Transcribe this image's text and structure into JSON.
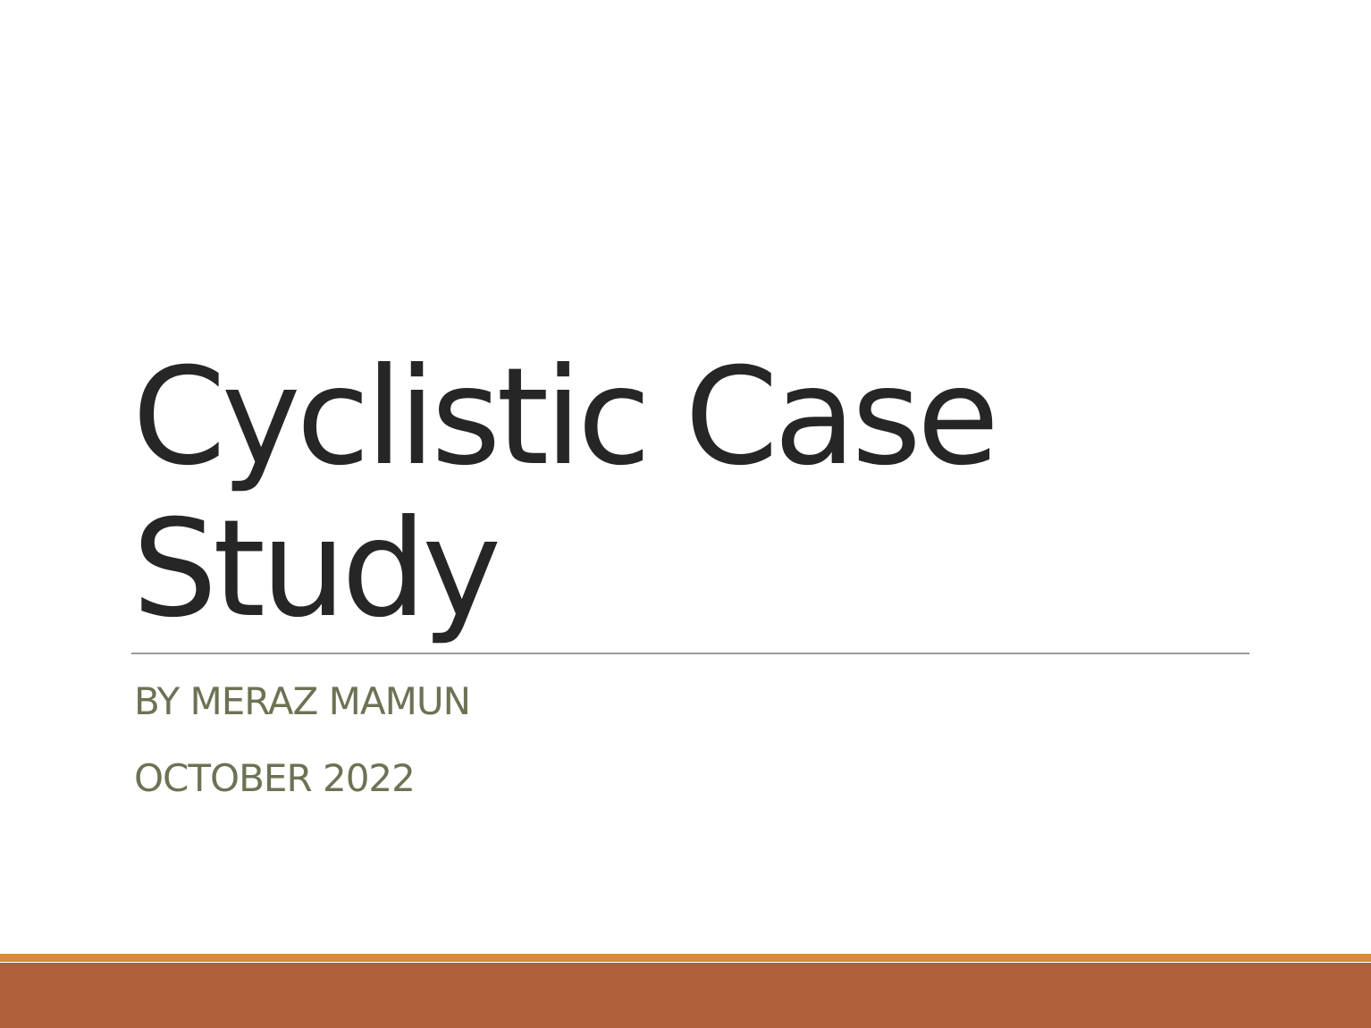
{
  "slide": {
    "title_line_1": "Cyclistic Case",
    "title_line_2": "Study",
    "subtitle": "BY MERAZ MAMUN",
    "date": "OCTOBER 2022"
  },
  "colors": {
    "title_text": "#262626",
    "subtitle_text": "#6b7354",
    "divider": "#9a9a9a",
    "footer_accent_thin": "#d88b34",
    "footer_accent_thick": "#b06038"
  }
}
